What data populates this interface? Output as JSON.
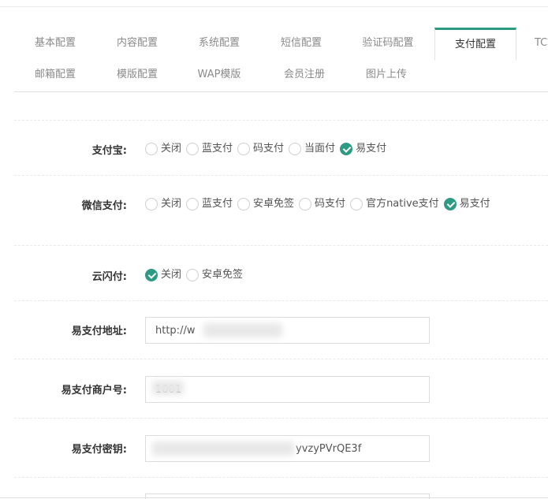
{
  "tabs": [
    {
      "label": "基本配置"
    },
    {
      "label": "内容配置"
    },
    {
      "label": "系统配置"
    },
    {
      "label": "短信配置"
    },
    {
      "label": "验证码配置"
    },
    {
      "label": "支付配置"
    },
    {
      "label": "TC"
    },
    {
      "label": "邮箱配置"
    },
    {
      "label": "模版配置"
    },
    {
      "label": "WAP模版"
    },
    {
      "label": "会员注册"
    },
    {
      "label": "图片上传"
    }
  ],
  "active_tab": "支付配置",
  "form": {
    "alipay": {
      "label": "支付宝:",
      "options": [
        "关闭",
        "蓝支付",
        "码支付",
        "当面付",
        "易支付"
      ],
      "selected": "易支付"
    },
    "wechat": {
      "label": "微信支付:",
      "options": [
        "关闭",
        "蓝支付",
        "安卓免签",
        "码支付",
        "官方native支付",
        "易支付"
      ],
      "selected": "易支付"
    },
    "unionpay": {
      "label": "云闪付:",
      "options": [
        "关闭",
        "安卓免签"
      ],
      "selected": "关闭"
    },
    "epay_url": {
      "label": "易支付地址:",
      "value": "http://w"
    },
    "epay_merchant": {
      "label": "易支付商户号:",
      "value": "1001"
    },
    "epay_key": {
      "label": "易支付密钥:",
      "value": "yvzyPVrQE3f"
    }
  },
  "colors": {
    "accent": "#2d9a84"
  }
}
